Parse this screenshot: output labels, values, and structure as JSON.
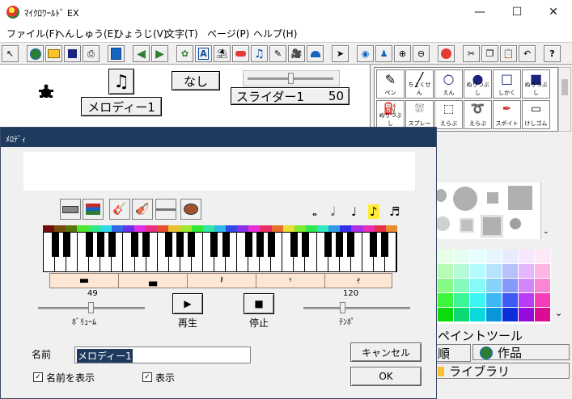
{
  "window": {
    "title": "ﾏｲｸﾛﾜｰﾙﾄﾞ EX",
    "minimize": "—",
    "maximize": "☐",
    "close": "✕"
  },
  "menu": {
    "file": "ファイル(F)",
    "edit": "へんしゅう(E)",
    "view": "ひょうじ(V)",
    "text": "文字(T)",
    "page": "ページ(P)",
    "help": "ヘルプ(H)"
  },
  "stage": {
    "none_button": "なし",
    "melody_caption": "メロディー1",
    "slider_caption": "スライダー1",
    "slider_value": "50",
    "slider_level": 0.5
  },
  "tools": {
    "pen": "ペン",
    "line": "ちょくせん",
    "circle": "えん",
    "fill_circle": "ぬりつぶし",
    "rect": "しかく",
    "fill_rect": "ぬりつぶし",
    "fill": "ぬりつぶし",
    "spray": "スプレー",
    "select": "えらぶ",
    "lasso": "えらぶ",
    "dropper": "スポイト",
    "eraser": "けしゴム"
  },
  "rightpanel": {
    "paint_tool_label": "ペイントツール",
    "tab_partial": "順",
    "tab_works": "作品",
    "tab_library": "ライブラリ"
  },
  "dialog": {
    "title": "ﾒﾛﾃﾞｨ",
    "volume_value": "49",
    "volume_label": "ﾎﾞﾘｭｰﾑ",
    "volume_level": 0.49,
    "tempo_value": "120",
    "tempo_label": "ﾃﾝﾎﾟ",
    "play_label": "再生",
    "stop_label": "停止",
    "name_label": "名前",
    "name_value": "メロディー1",
    "show_name_label": "名前を表示",
    "show_label": "表示",
    "show_name_checked": true,
    "show_checked": true,
    "cancel_button": "キャンセル",
    "ok_button": "OK",
    "check_mark": "✓",
    "colors": {
      "title_bg": "#1f3a5f",
      "rest_bar": "#fbe7d4"
    }
  }
}
